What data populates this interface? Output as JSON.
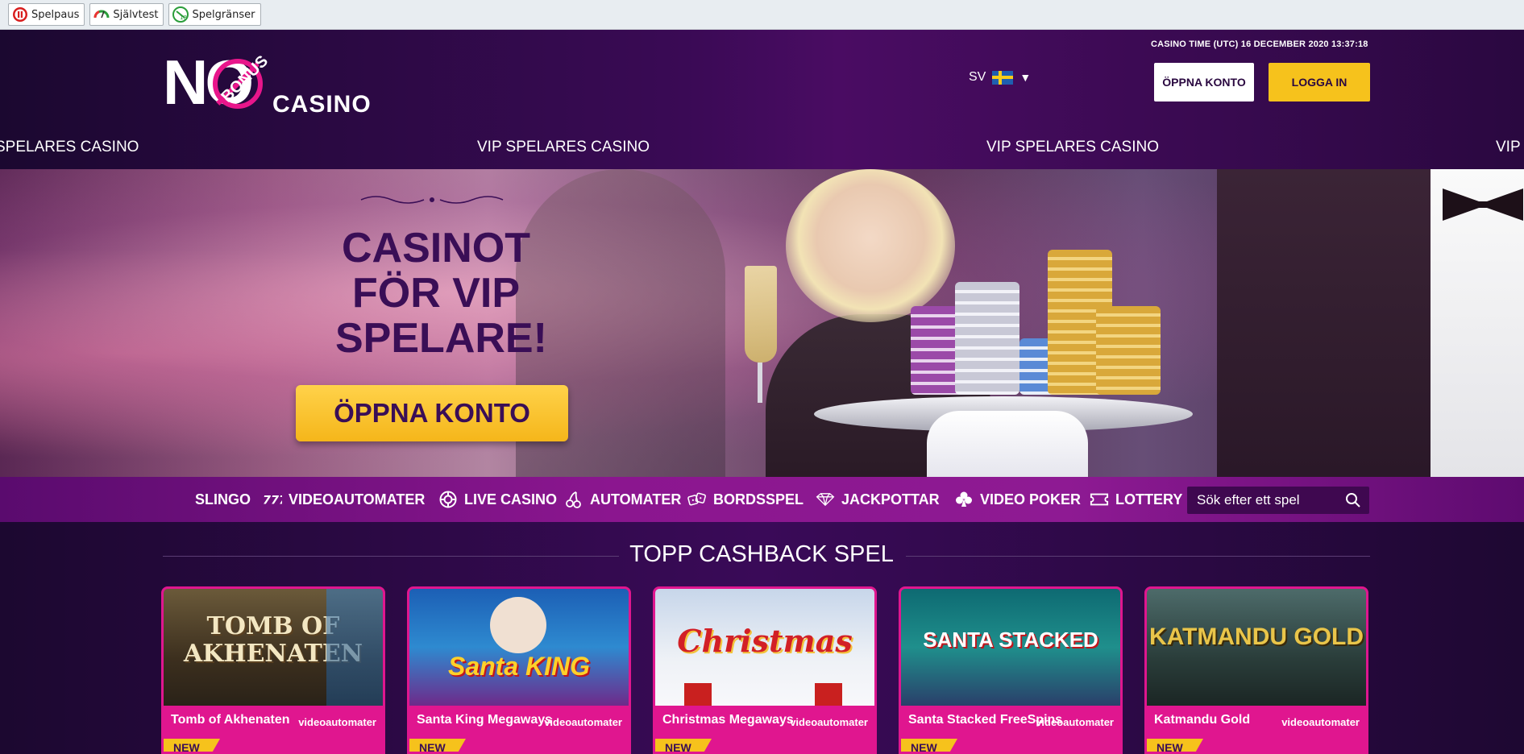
{
  "rg_bar": {
    "items": [
      {
        "label": "Spelpaus",
        "icon": "pause-icon"
      },
      {
        "label": "Självtest",
        "icon": "gauge-icon"
      },
      {
        "label": "Spelgränser",
        "icon": "limits-icon"
      }
    ]
  },
  "header": {
    "logo_no": "NO",
    "logo_bonus": "BONUS",
    "logo_casino": "CASINO",
    "casino_time": "CASINO TIME (UTC)  16 DECEMBER 2020  13:37:18",
    "language": "SV",
    "open_account": "ÖPPNA KONTO",
    "login": "LOGGA IN"
  },
  "ticker": {
    "items": [
      "SPELARES CASINO",
      "VIP SPELARES CASINO",
      "VIP SPELARES CASINO",
      "VIP"
    ]
  },
  "hero": {
    "title_lines": [
      "CASINOT",
      "FÖR VIP",
      "SPELARE!"
    ],
    "cta": "ÖPPNA KONTO"
  },
  "nav": {
    "items": [
      {
        "label": "SLINGO",
        "icon": ""
      },
      {
        "label": "VIDEOAUTOMATER",
        "icon": "sevens-icon"
      },
      {
        "label": "LIVE CASINO",
        "icon": "roulette-icon"
      },
      {
        "label": "AUTOMATER",
        "icon": "cherry-icon"
      },
      {
        "label": "BORDSSPEL",
        "icon": "dice-icon"
      },
      {
        "label": "JACKPOTTAR",
        "icon": "diamond-icon"
      },
      {
        "label": "VIDEO POKER",
        "icon": "club-icon"
      },
      {
        "label": "LOTTERY",
        "icon": "ticket-icon"
      }
    ],
    "search_placeholder": "Sök efter ett spel"
  },
  "section": {
    "title": "TOPP CASHBACK SPEL"
  },
  "games": [
    {
      "name": "Tomb of Akhenaten",
      "category": "videoautomater",
      "badge": "NEW",
      "logo": "TOMB OF AKHENATEN"
    },
    {
      "name": "Santa King Megaways",
      "category": "videoautomater",
      "badge": "NEW",
      "logo": "Santa KING"
    },
    {
      "name": "Christmas Megaways",
      "category": "videoautomater",
      "badge": "NEW",
      "logo": "Christmas"
    },
    {
      "name": "Santa Stacked FreeSpins",
      "category": "videoautomater",
      "badge": "NEW",
      "logo": "SANTA STACKED"
    },
    {
      "name": "Katmandu Gold",
      "category": "videoautomater",
      "badge": "NEW",
      "logo": "KATMANDU GOLD"
    }
  ],
  "colors": {
    "accent_pink": "#e0168f",
    "accent_yellow": "#f6c21c",
    "deep_purple": "#3a0e56"
  }
}
